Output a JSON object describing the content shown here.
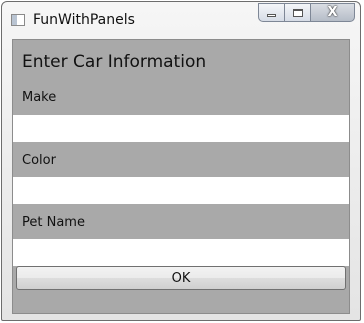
{
  "window": {
    "title": "FunWithPanels",
    "close_glyph": "X"
  },
  "form": {
    "heading": "Enter Car Information",
    "fields": [
      {
        "label": "Make",
        "value": ""
      },
      {
        "label": "Color",
        "value": ""
      },
      {
        "label": "Pet Name",
        "value": ""
      }
    ],
    "ok_label": "OK"
  },
  "icons": {
    "app": "window-app-icon",
    "minimize": "minimize-icon",
    "maximize": "maximize-icon",
    "close": "close-icon"
  },
  "colors": {
    "panel_background": "#a9a9a9",
    "input_background": "#ffffff"
  }
}
